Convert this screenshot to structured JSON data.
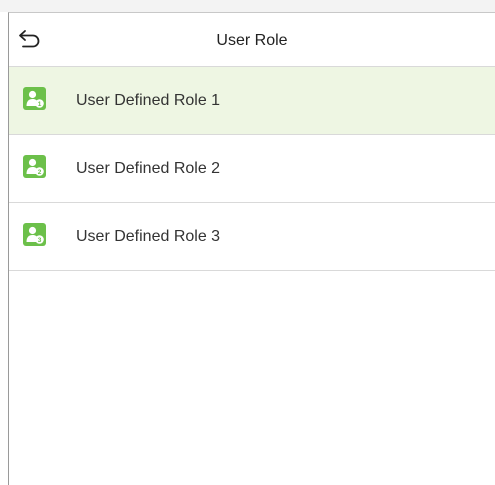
{
  "header": {
    "title": "User Role",
    "back_icon": "back-arrow-icon"
  },
  "colors": {
    "accent": "#6cc04a",
    "selected_background": "#eef6e3",
    "divider": "#d9d9d9"
  },
  "roles": [
    {
      "label": "User Defined Role 1",
      "badge": "1",
      "icon": "user-role-icon",
      "selected": true
    },
    {
      "label": "User Defined Role 2",
      "badge": "2",
      "icon": "user-role-icon",
      "selected": false
    },
    {
      "label": "User Defined Role 3",
      "badge": "3",
      "icon": "user-role-icon",
      "selected": false
    }
  ]
}
